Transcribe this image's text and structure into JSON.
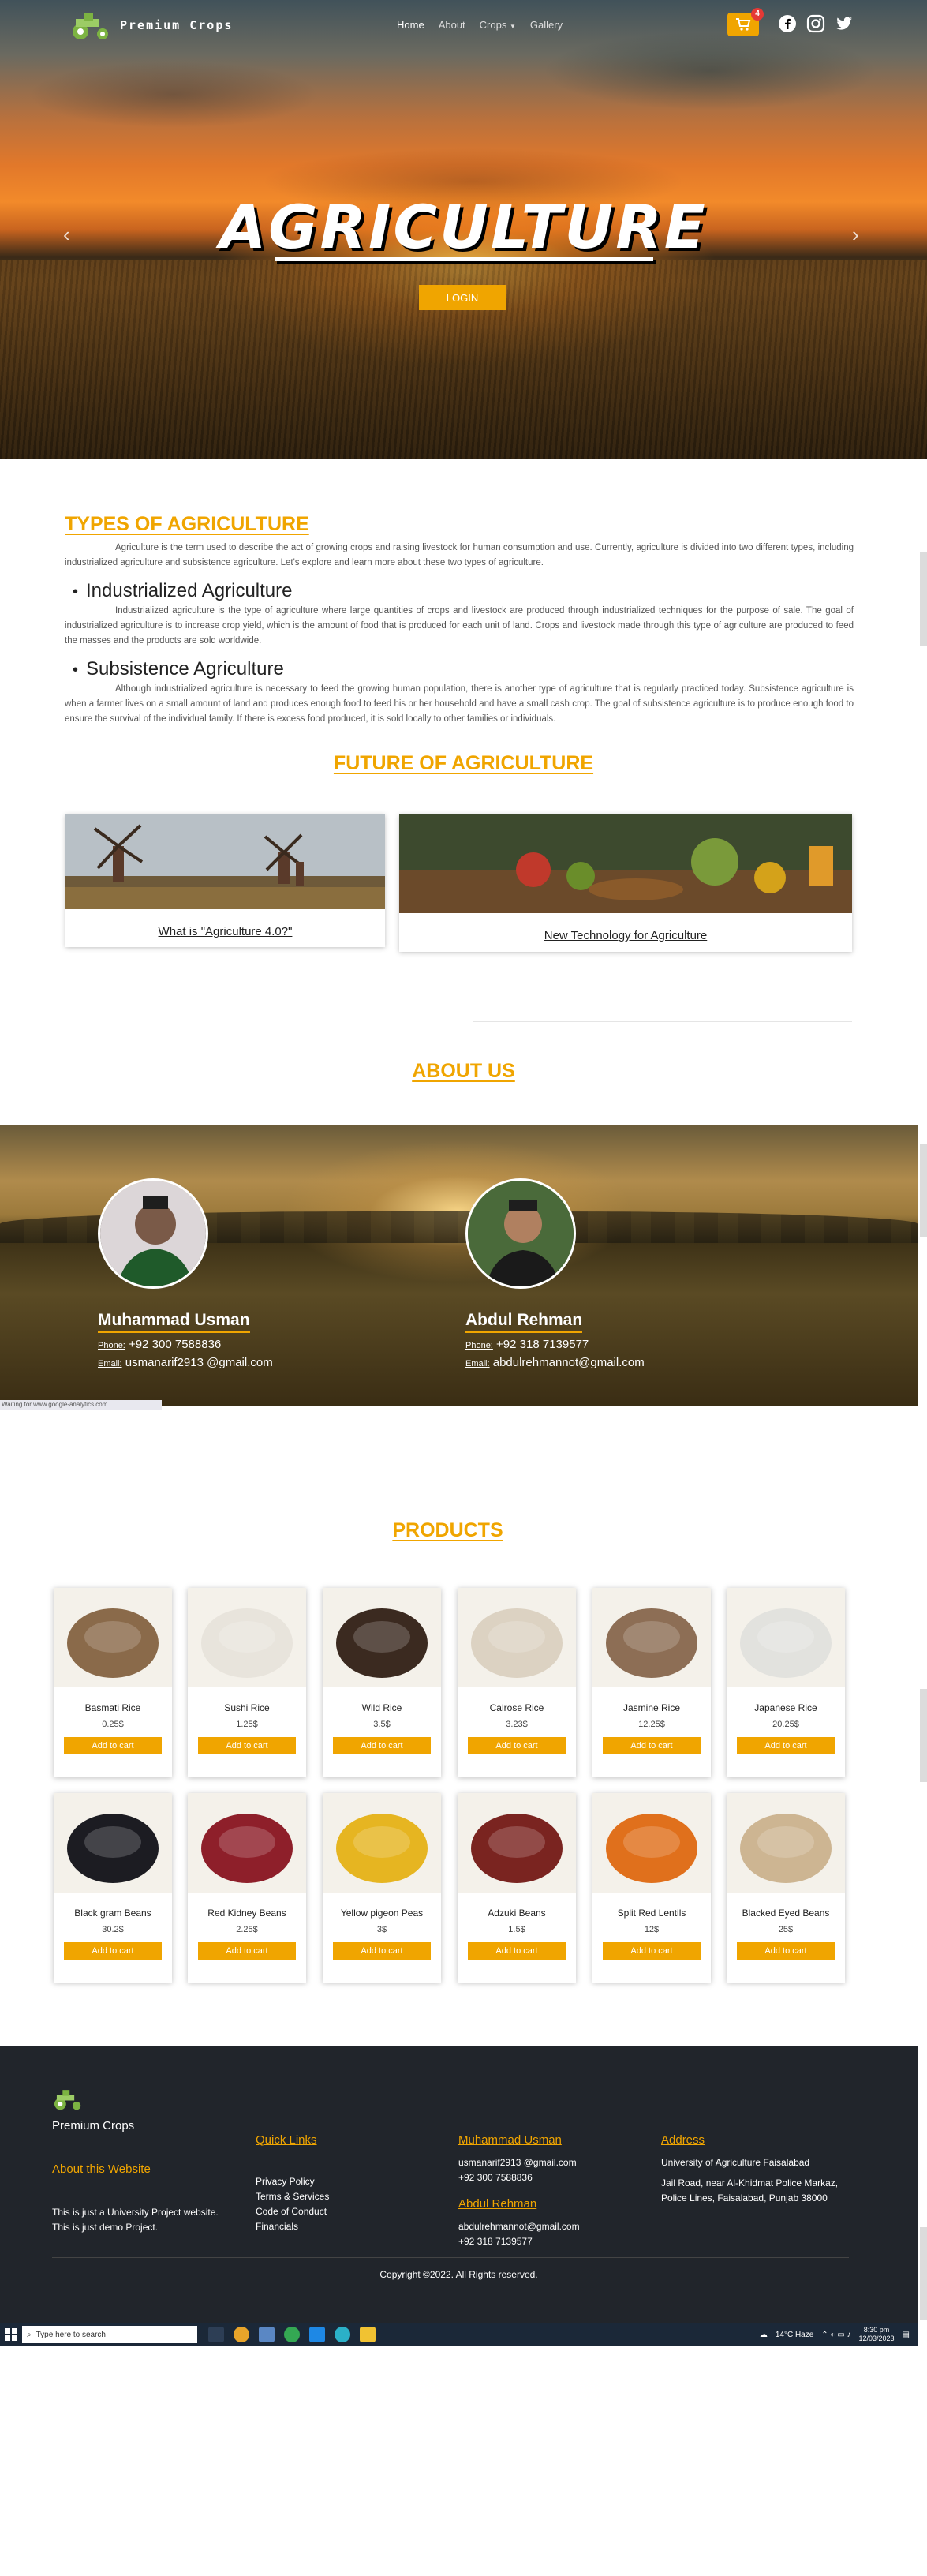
{
  "brand": {
    "name": "Premium Crops"
  },
  "nav": {
    "items": [
      "Home",
      "About",
      "Crops",
      "Gallery"
    ]
  },
  "cart": {
    "count": "4"
  },
  "hero": {
    "title": "AGRICULTURE",
    "button": "LOGIN",
    "prev": "‹",
    "next": "›"
  },
  "types": {
    "heading": "TYPES OF AGRICULTURE",
    "intro": "Agriculture is the term used to describe the act of growing crops and raising livestock for human consumption and use. Currently, agriculture is divided into two different types, including industrialized agriculture and subsistence agriculture. Let's explore and learn more about these two types of agriculture.",
    "items": [
      {
        "title": "Industrialized Agriculture",
        "text": "Industrialized agriculture is the type of agriculture where large quantities of crops and livestock are produced through industrialized techniques for the purpose of sale. The goal of industrialized agriculture is to increase crop yield, which is the amount of food that is produced for each unit of land. Crops and livestock made through this type of agriculture are produced to feed the masses and the products are sold worldwide."
      },
      {
        "title": "Subsistence Agriculture",
        "text": "Although industrialized agriculture is necessary to feed the growing human population, there is another type of agriculture that is regularly practiced today. Subsistence agriculture is when a farmer lives on a small amount of land and produces enough food to feed his or her household and have a small cash crop. The goal of subsistence agriculture is to produce enough food to ensure the survival of the individual family. If there is excess food produced, it is sold locally to other families or individuals."
      }
    ]
  },
  "future": {
    "heading": "FUTURE OF AGRICULTURE",
    "cards": [
      {
        "caption": "What is \"Agriculture 4.0?\""
      },
      {
        "caption": "New Technology for Agriculture"
      }
    ]
  },
  "about": {
    "heading": "ABOUT US",
    "phone_label": "Phone:",
    "email_label": "Email:",
    "members": [
      {
        "name": "Muhammad Usman",
        "phone": "+92 300 7588836",
        "email": "usmanarif2913 @gmail.com"
      },
      {
        "name": "Abdul Rehman",
        "phone": "+92 318 7139577",
        "email": "abdulrehmannot@gmail.com"
      }
    ]
  },
  "browser_status": "Waiting for www.google-analytics.com...",
  "products": {
    "heading": "PRODUCTS",
    "add_label": "Add to cart",
    "items": [
      {
        "name": "Basmati Rice",
        "price": "0.25$",
        "color": "#8a6a4a"
      },
      {
        "name": "Sushi Rice",
        "price": "1.25$",
        "color": "#e8e4dc"
      },
      {
        "name": "Wild Rice",
        "price": "3.5$",
        "color": "#3b2a20"
      },
      {
        "name": "Calrose Rice",
        "price": "3.23$",
        "color": "#dcd2c2"
      },
      {
        "name": "Jasmine Rice",
        "price": "12.25$",
        "color": "#8d6e55"
      },
      {
        "name": "Japanese Rice",
        "price": "20.25$",
        "color": "#e2e2de"
      },
      {
        "name": "Black gram Beans",
        "price": "30.2$",
        "color": "#1c1c22"
      },
      {
        "name": "Red Kidney Beans",
        "price": "2.25$",
        "color": "#8e1f2a"
      },
      {
        "name": "Yellow pigeon Peas",
        "price": "3$",
        "color": "#e6b521"
      },
      {
        "name": "Adzuki Beans",
        "price": "1.5$",
        "color": "#7a2420"
      },
      {
        "name": "Split Red Lentils",
        "price": "12$",
        "color": "#e0701c"
      },
      {
        "name": "Blacked Eyed Beans",
        "price": "25$",
        "color": "#cdb592"
      }
    ]
  },
  "footer": {
    "brand": "Premium Crops",
    "about_heading": "About this Website",
    "about_lines": [
      "This is just a University Project website.",
      "This is just demo Project."
    ],
    "links_heading": "Quick Links",
    "links": [
      "Privacy Policy",
      "Terms & Services",
      "Code of Conduct",
      "Financials"
    ],
    "contact1": {
      "name": "Muhammad Usman",
      "email": "usmanarif2913 @gmail.com",
      "phone": "+92 300 7588836"
    },
    "contact2": {
      "name": "Abdul Rehman",
      "email": "abdulrehmannot@gmail.com",
      "phone": "+92 318 7139577"
    },
    "address_heading": "Address",
    "address_lines": [
      "University of Agriculture Faisalabad",
      "Jail Road, near Al-Khidmat Police Markaz,",
      "Police Lines, Faisalabad, Punjab 38000"
    ],
    "copyright": "Copyright ©2022. All Rights reserved."
  },
  "taskbar": {
    "search_placeholder": "Type here to search",
    "weather": "14°C  Haze",
    "time": "8:30 pm",
    "date": "12/03/2023"
  },
  "colors": {
    "accent": "#f0a500",
    "footer_bg": "#21252b"
  }
}
